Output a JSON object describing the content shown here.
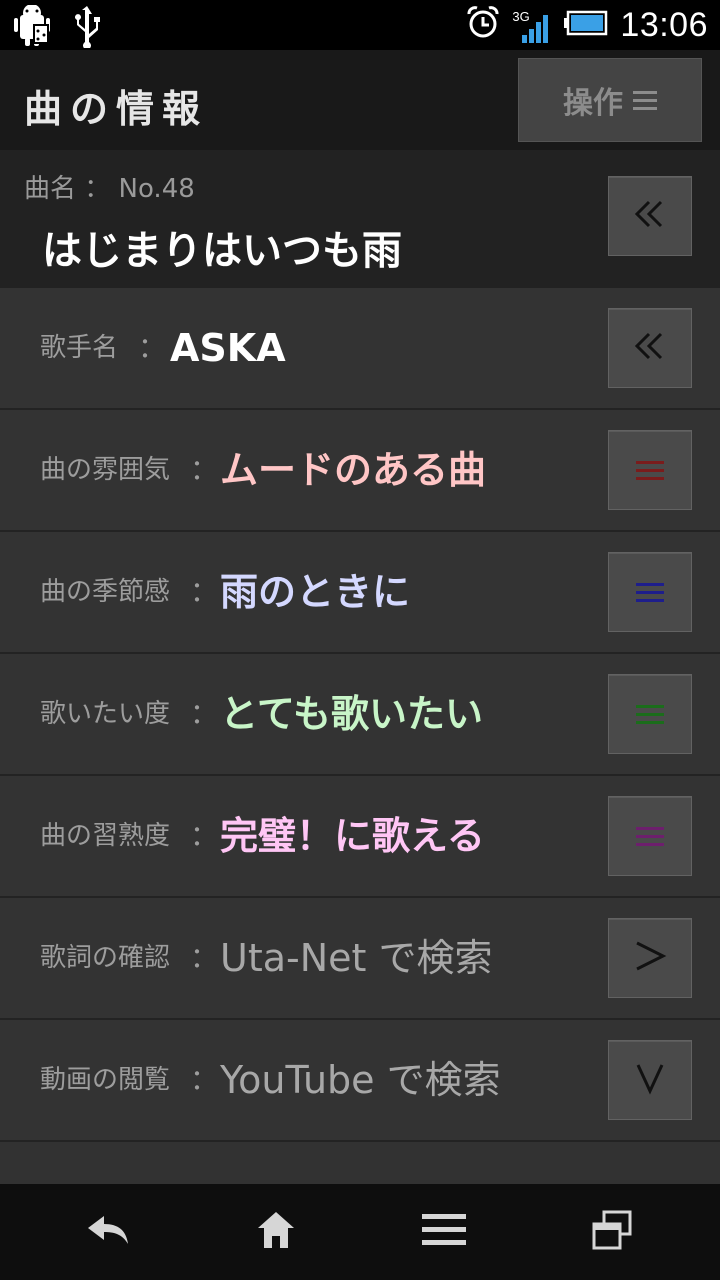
{
  "status_bar": {
    "time": "13:06",
    "network": "3G",
    "icons": [
      "android-debug-icon",
      "usb-icon",
      "alarm-icon",
      "signal-icon",
      "battery-icon"
    ]
  },
  "header": {
    "title": "曲の情報",
    "operation_button": "操作"
  },
  "song": {
    "label": "曲名 ： No.48",
    "title": "はじまりはいつも雨"
  },
  "rows": [
    {
      "label": "歌手名",
      "value": "ASKA",
      "color": "#ffffff",
      "button": "double-chevron-left-icon"
    },
    {
      "label": "曲の雰囲気",
      "value": "ムードのある曲",
      "color": "#ffc6c6",
      "button": "menu-icon",
      "button_color": "#7a1c1c"
    },
    {
      "label": "曲の季節感",
      "value": "雨のときに",
      "color": "#d4d8ff",
      "button": "menu-icon",
      "button_color": "#1e1e8c"
    },
    {
      "label": "歌いたい度",
      "value": "とても歌いたい",
      "color": "#c8f5c8",
      "button": "menu-icon",
      "button_color": "#1b6d1b"
    },
    {
      "label": "曲の習熟度",
      "value": "完璧！に歌える",
      "color": "#ffc6f5",
      "button": "menu-icon",
      "button_color": "#6d1f6d"
    },
    {
      "label": "歌詞の確認",
      "value": "Uta-Net で検索",
      "color": "#a8a8a8",
      "button": "chevron-right-icon"
    },
    {
      "label": "動画の閲覧",
      "value": "YouTube で検索",
      "color": "#a8a8a8",
      "button": "chevron-down-icon"
    }
  ],
  "colon": "：",
  "nav_bar": [
    "back-icon",
    "home-icon",
    "menu-icon",
    "recent-apps-icon"
  ]
}
